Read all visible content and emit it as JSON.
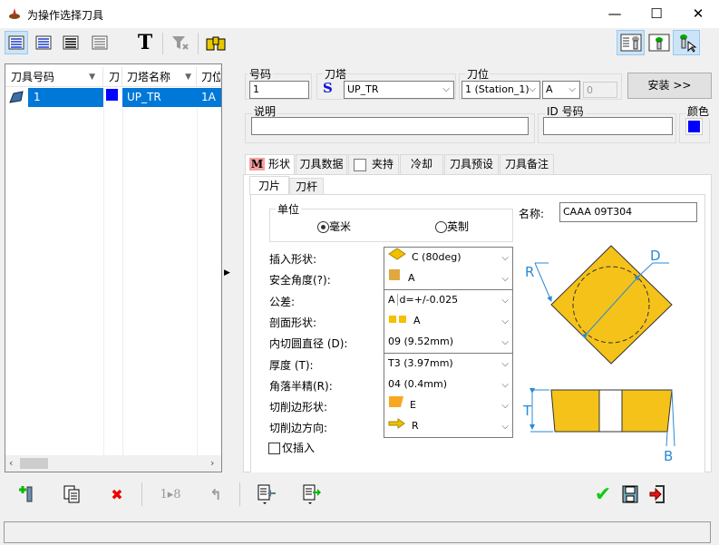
{
  "window": {
    "title": "为操作选择刀具",
    "minimize": "—",
    "maximize": "☐",
    "close": "✕"
  },
  "toolbar": {
    "text_tool": "T"
  },
  "list": {
    "columns": [
      "刀具号码",
      "刀",
      "刀塔名称",
      "刀位"
    ],
    "rows": [
      {
        "number": "1",
        "color": "#0000ff",
        "turret": "UP_TR",
        "station": "1A"
      }
    ]
  },
  "fields": {
    "number": {
      "label": "号码",
      "value": "1"
    },
    "turret": {
      "label": "刀塔",
      "prefix": "S",
      "value": "UP_TR"
    },
    "station": {
      "label": "刀位",
      "value": "1 (Station_1)",
      "sub": "A",
      "offset": "0"
    },
    "install_button": "安装 >>",
    "description": {
      "label": "说明",
      "value": ""
    },
    "id": {
      "label": "ID 号码",
      "value": ""
    },
    "color": {
      "label": "颜色",
      "value": "#0000ff"
    }
  },
  "tabs": [
    {
      "label": "形状",
      "icon": "M",
      "active": true
    },
    {
      "label": "刀具数据"
    },
    {
      "label": "夹持"
    },
    {
      "label": "冷却"
    },
    {
      "label": "刀具预设"
    },
    {
      "label": "刀具备注"
    }
  ],
  "subtabs": [
    {
      "label": "刀片",
      "active": true
    },
    {
      "label": "刀杆"
    }
  ],
  "units": {
    "label": "单位",
    "options": [
      "毫米",
      "英制"
    ],
    "selected": "毫米"
  },
  "name": {
    "label": "名称:",
    "value": "CAAA 09T304"
  },
  "params": [
    {
      "label": "插入形状:",
      "value": "C (80deg)"
    },
    {
      "label": "安全角度(?):",
      "value": "A"
    },
    {
      "label": "公差:",
      "value": "d=+/-0.025",
      "prefix": "A"
    },
    {
      "label": "剖面形状:",
      "value": "A"
    },
    {
      "label": "内切圆直径 (D):",
      "value": "09 (9.52mm)"
    },
    {
      "label": "厚度 (T):",
      "value": "T3 (3.97mm)"
    },
    {
      "label": "角落半精(R):",
      "value": "04 (0.4mm)"
    },
    {
      "label": "切削边形状:",
      "value": "E"
    },
    {
      "label": "切削边方向:",
      "value": "R"
    }
  ],
  "insert_only": {
    "label": "仅插入",
    "checked": false
  },
  "diagram": {
    "labels": {
      "R": "R",
      "D": "D",
      "T": "T",
      "B": "B"
    },
    "fill": "#f5c21a",
    "dim_color": "#2a8ad4"
  },
  "bottom": {
    "renumber": "1▸8"
  },
  "status": ""
}
